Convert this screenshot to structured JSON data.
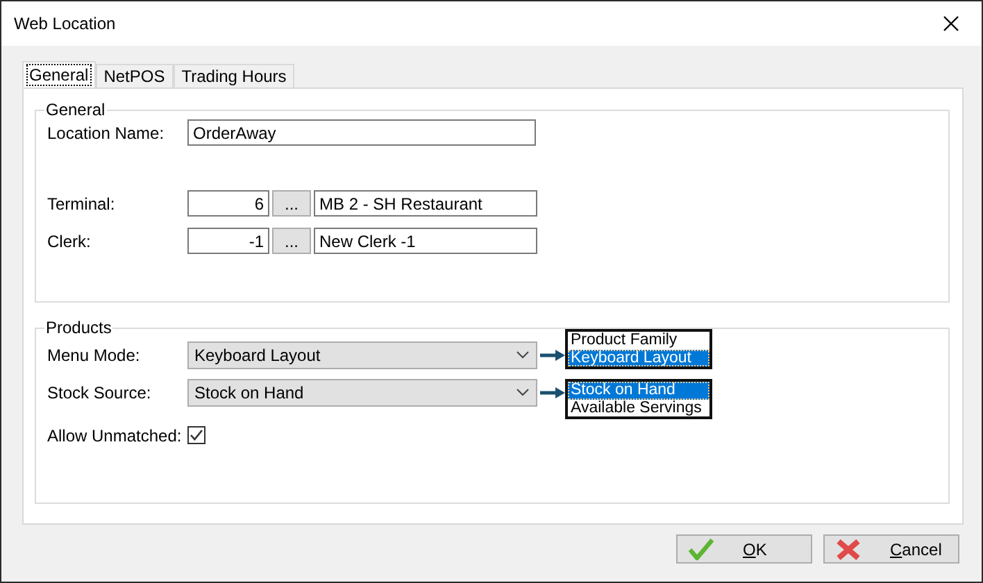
{
  "window": {
    "title": "Web Location"
  },
  "tabs": [
    {
      "label": "General",
      "selected": true
    },
    {
      "label": "NetPOS",
      "selected": false
    },
    {
      "label": "Trading Hours",
      "selected": false
    }
  ],
  "groups": [
    {
      "title": "General",
      "fields": [
        {
          "kind": "text",
          "label": "Location Name:",
          "value": "OrderAway"
        },
        {
          "kind": "lookup",
          "label": "Terminal:",
          "number": "6",
          "browse": "...",
          "name": "MB 2 - SH Restaurant"
        },
        {
          "kind": "lookup",
          "label": "Clerk:",
          "number": "-1",
          "browse": "...",
          "name": "New Clerk -1"
        }
      ]
    },
    {
      "title": "Products",
      "fields": [
        {
          "kind": "combo",
          "label": "Menu Mode:",
          "value": "Keyboard Layout",
          "options": [
            {
              "label": "Product Family",
              "selected": false
            },
            {
              "label": "Keyboard Layout",
              "selected": true
            }
          ]
        },
        {
          "kind": "combo",
          "label": "Stock Source:",
          "value": "Stock on Hand",
          "options": [
            {
              "label": "Stock on Hand",
              "selected": true
            },
            {
              "label": "Available Servings",
              "selected": false
            }
          ]
        },
        {
          "kind": "checkbox",
          "label": "Allow Unmatched:",
          "checked": true
        }
      ]
    }
  ],
  "buttons": [
    {
      "kind": "ok",
      "label": "OK",
      "underlined_access_key": true
    },
    {
      "kind": "cancel",
      "label": "Cancel",
      "underlined_access_key": true
    }
  ]
}
